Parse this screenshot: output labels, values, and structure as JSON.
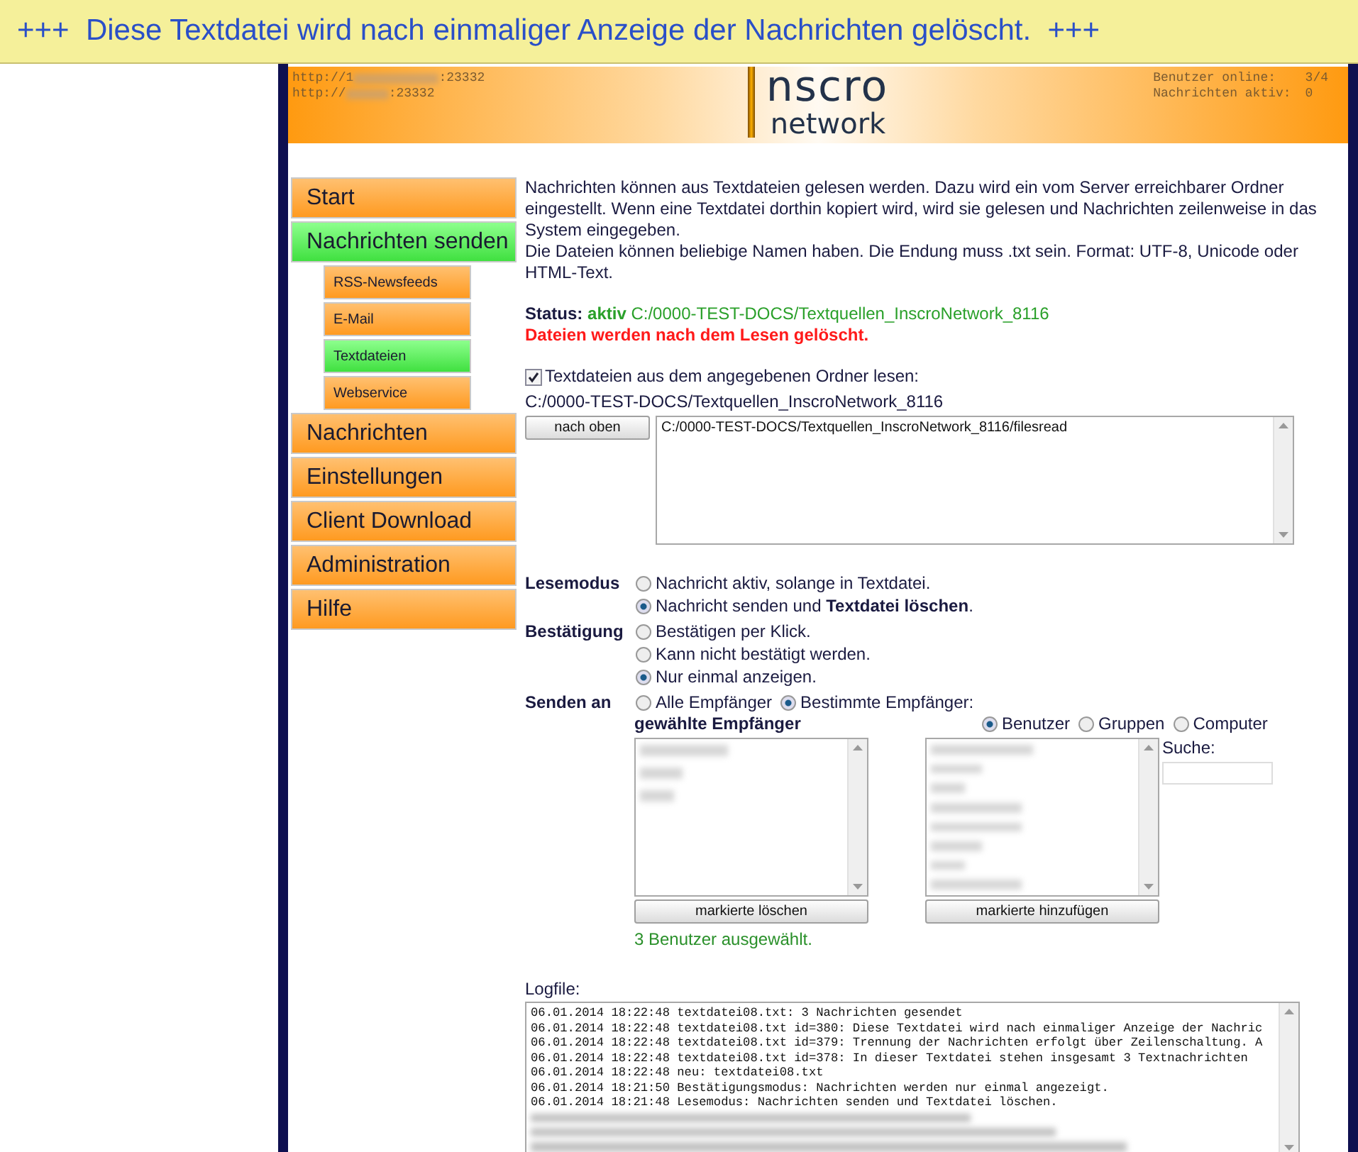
{
  "banner": {
    "text": "+++  Diese Textdatei wird nach einmaliger Anzeige der Nachrichten gelöscht.  +++"
  },
  "header": {
    "servers": [
      {
        "prefix": "http://1",
        "suffix": ":23332"
      },
      {
        "prefix": "http://",
        "suffix": ":23332"
      }
    ],
    "logo": {
      "top": "nscro",
      "bottom": "network"
    },
    "stats": [
      {
        "label": "Benutzer online:",
        "value": "3/4"
      },
      {
        "label": "Nachrichten aktiv:",
        "value": "0"
      }
    ]
  },
  "nav": [
    {
      "label": "Start",
      "selected": false
    },
    {
      "label": "Nachrichten senden",
      "selected": true,
      "children": [
        {
          "label": "RSS-Newsfeeds",
          "selected": false
        },
        {
          "label": "E-Mail",
          "selected": false
        },
        {
          "label": "Textdateien",
          "selected": true
        },
        {
          "label": "Webservice",
          "selected": false
        }
      ]
    },
    {
      "label": "Nachrichten",
      "selected": false
    },
    {
      "label": "Einstellungen",
      "selected": false
    },
    {
      "label": "Client Download",
      "selected": false
    },
    {
      "label": "Administration",
      "selected": false
    },
    {
      "label": "Hilfe",
      "selected": false
    }
  ],
  "intro": [
    "Nachrichten können aus Textdateien gelesen werden. Dazu wird ein vom Server erreichbarer Ordner eingestellt. Wenn eine Textdatei dorthin kopiert wird, wird sie gelesen und Nachrichten zeilenweise in das System eingegeben.",
    "Die Dateien können beliebige Namen haben. Die Endung muss .txt sein. Format: UTF-8, Unicode oder HTML-Text."
  ],
  "status": {
    "label": "Status:",
    "state": "aktiv",
    "path": "C:/0000-TEST-DOCS/Textquellen_InscroNetwork_8116",
    "warning": "Dateien werden nach dem Lesen gelöscht."
  },
  "read_folder": {
    "checked": true,
    "label": "Textdateien aus dem angegebenen Ordner lesen:",
    "path": "C:/0000-TEST-DOCS/Textquellen_InscroNetwork_8116"
  },
  "folder_up_button": "nach oben",
  "folder_list": [
    "C:/0000-TEST-DOCS/Textquellen_InscroNetwork_8116/filesread"
  ],
  "options": [
    {
      "label": "Lesemodus",
      "inline": false,
      "choices": [
        {
          "label": "Nachricht aktiv, solange in Textdatei.",
          "selected": false
        },
        {
          "label": "Nachricht senden und **Textdatei löschen**.",
          "selected": true
        }
      ]
    },
    {
      "label": "Bestätigung",
      "inline": false,
      "choices": [
        {
          "label": "Bestätigen per Klick.",
          "selected": false
        },
        {
          "label": "Kann nicht bestätigt werden.",
          "selected": false
        },
        {
          "label": "Nur einmal anzeigen.",
          "selected": true
        }
      ]
    },
    {
      "label": "Senden an",
      "inline": true,
      "choices": [
        {
          "label": "Alle Empfänger",
          "selected": false
        },
        {
          "label": "Bestimmte Empfänger:",
          "selected": true
        }
      ]
    }
  ],
  "recipients": {
    "title": "gewählte Empfänger",
    "types": [
      {
        "label": "Benutzer",
        "selected": true
      },
      {
        "label": "Gruppen",
        "selected": false
      },
      {
        "label": "Computer",
        "selected": false
      }
    ],
    "remove_button": "markierte löschen",
    "add_button": "markierte hinzufügen",
    "search_label": "Suche:",
    "summary": "3 Benutzer ausgewählt."
  },
  "logfile": {
    "label": "Logfile:",
    "lines": [
      "06.01.2014 18:22:48 textdatei08.txt: 3 Nachrichten gesendet",
      "06.01.2014 18:22:48 textdatei08.txt id=380: Diese Textdatei wird nach einmaliger Anzeige der Nachric",
      "06.01.2014 18:22:48 textdatei08.txt id=379: Trennung der Nachrichten erfolgt über Zeilenschaltung. A",
      "06.01.2014 18:22:48 textdatei08.txt id=378: In dieser Textdatei stehen insgesamt 3 Textnachrichten",
      "06.01.2014 18:22:48 neu: textdatei08.txt",
      "06.01.2014 18:21:50 Bestätigungsmodus: Nachrichten werden nur einmal angezeigt.",
      "06.01.2014 18:21:48 Lesemodus: Nachrichten senden und Textdatei löschen."
    ]
  }
}
